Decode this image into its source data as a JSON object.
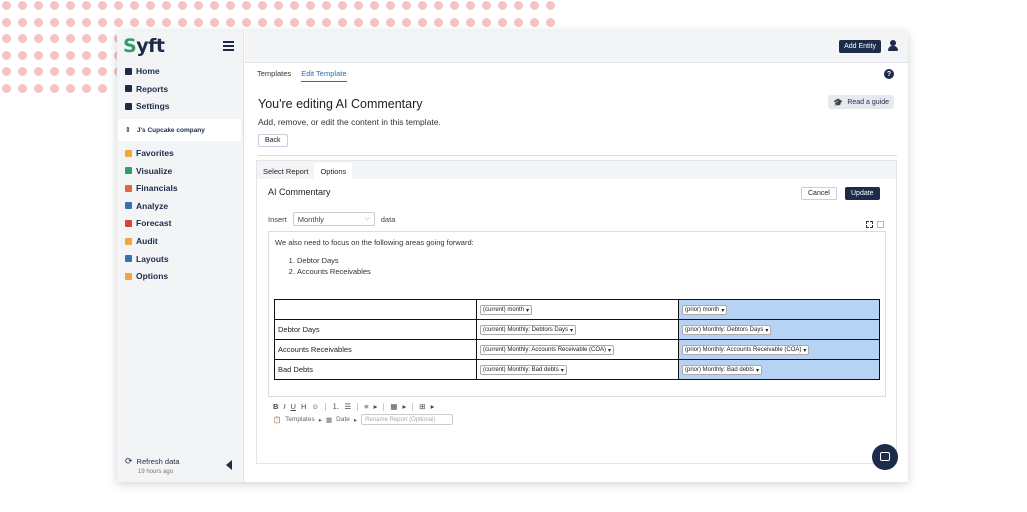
{
  "brand": {
    "logo_text": "yft",
    "logo_s": "S"
  },
  "sidebar": {
    "top_items": [
      {
        "label": "Home",
        "color": "#1c2b4a"
      },
      {
        "label": "Reports",
        "color": "#1c2b4a"
      },
      {
        "label": "Settings",
        "color": "#1c2b4a"
      }
    ],
    "company": "J's Cupcake company",
    "items": [
      {
        "label": "Favorites",
        "color": "#f3a53a"
      },
      {
        "label": "Visualize",
        "color": "#2e9e6a"
      },
      {
        "label": "Financials",
        "color": "#e0663c"
      },
      {
        "label": "Analyze",
        "color": "#3b6fb6"
      },
      {
        "label": "Forecast",
        "color": "#d3443c"
      },
      {
        "label": "Audit",
        "color": "#f3a53a"
      },
      {
        "label": "Layouts",
        "color": "#3b6fb6"
      },
      {
        "label": "Options",
        "color": "#f3a53a"
      }
    ],
    "refresh_label": "Refresh data",
    "refresh_time": "19 hours ago"
  },
  "topbar": {
    "add_entity": "Add Entity"
  },
  "main": {
    "tabs": [
      {
        "label": "Templates",
        "active": false
      },
      {
        "label": "Edit Template",
        "active": true
      }
    ],
    "title": "You're editing AI Commentary",
    "guide_label": "Read a guide",
    "subtitle": "Add, remove, or edit the content in this template.",
    "back_label": "Back"
  },
  "panel": {
    "tabs": [
      {
        "label": "Select Report",
        "active": false
      },
      {
        "label": "Options",
        "active": true
      }
    ],
    "section_title": "AI Commentary",
    "cancel_label": "Cancel",
    "update_label": "Update",
    "insert_label": "Insert",
    "insert_select": "Monthly",
    "insert_suffix": "data"
  },
  "editor": {
    "intro": "We also need to focus on the following areas going forward:",
    "list": [
      "Debtor Days",
      "Accounts Receivables"
    ],
    "table": {
      "header": [
        "",
        "(current) month",
        "(prior) month"
      ],
      "rows": [
        [
          "Debtor Days",
          "(current) Monthly: Debtors Days",
          "(prior) Monthly: Debtors Days"
        ],
        [
          "Accounts Receivables",
          "(current) Monthly: Accounts Receivable (COA)",
          "(prior) Monthly: Accounts Receivable (COA)"
        ],
        [
          "Bad Debts",
          "(current) Monthly: Bad debts",
          "(prior) Monthly: Bad debts"
        ]
      ]
    }
  },
  "toolbar": {
    "bold": "B",
    "italic": "I",
    "underline": "U",
    "heading": "H",
    "templates_label": "Templates",
    "date_label": "Date",
    "rename_placeholder": "Rename Report (Optional)"
  }
}
